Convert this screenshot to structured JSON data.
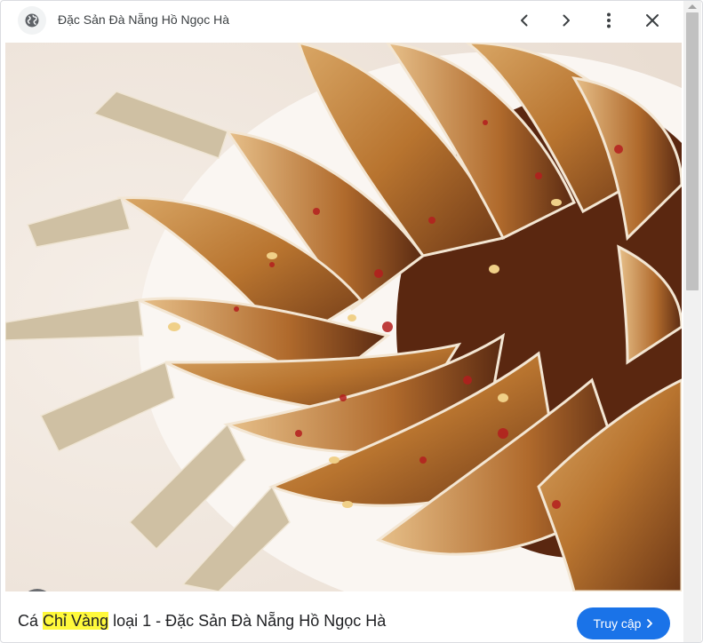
{
  "header": {
    "site_name": "Đặc Sản Đà Nẵng Hồ Ngọc Hà",
    "icons": {
      "site": "globe-icon",
      "prev": "chevron-left-icon",
      "next": "chevron-right-icon",
      "more": "more-vert-icon",
      "close": "close-icon"
    }
  },
  "image": {
    "lens_icon": "google-lens-icon"
  },
  "footer": {
    "caption_before": "Cá ",
    "caption_highlight": "Chỉ Vàng",
    "caption_after": " loại 1 - Đặc Sản Đà Nẵng Hồ Ngọc Hà",
    "visit_label": "Truy cập",
    "visit_icon": "chevron-right-icon"
  },
  "colors": {
    "accent": "#1a73e8",
    "highlight": "#fff93b"
  }
}
